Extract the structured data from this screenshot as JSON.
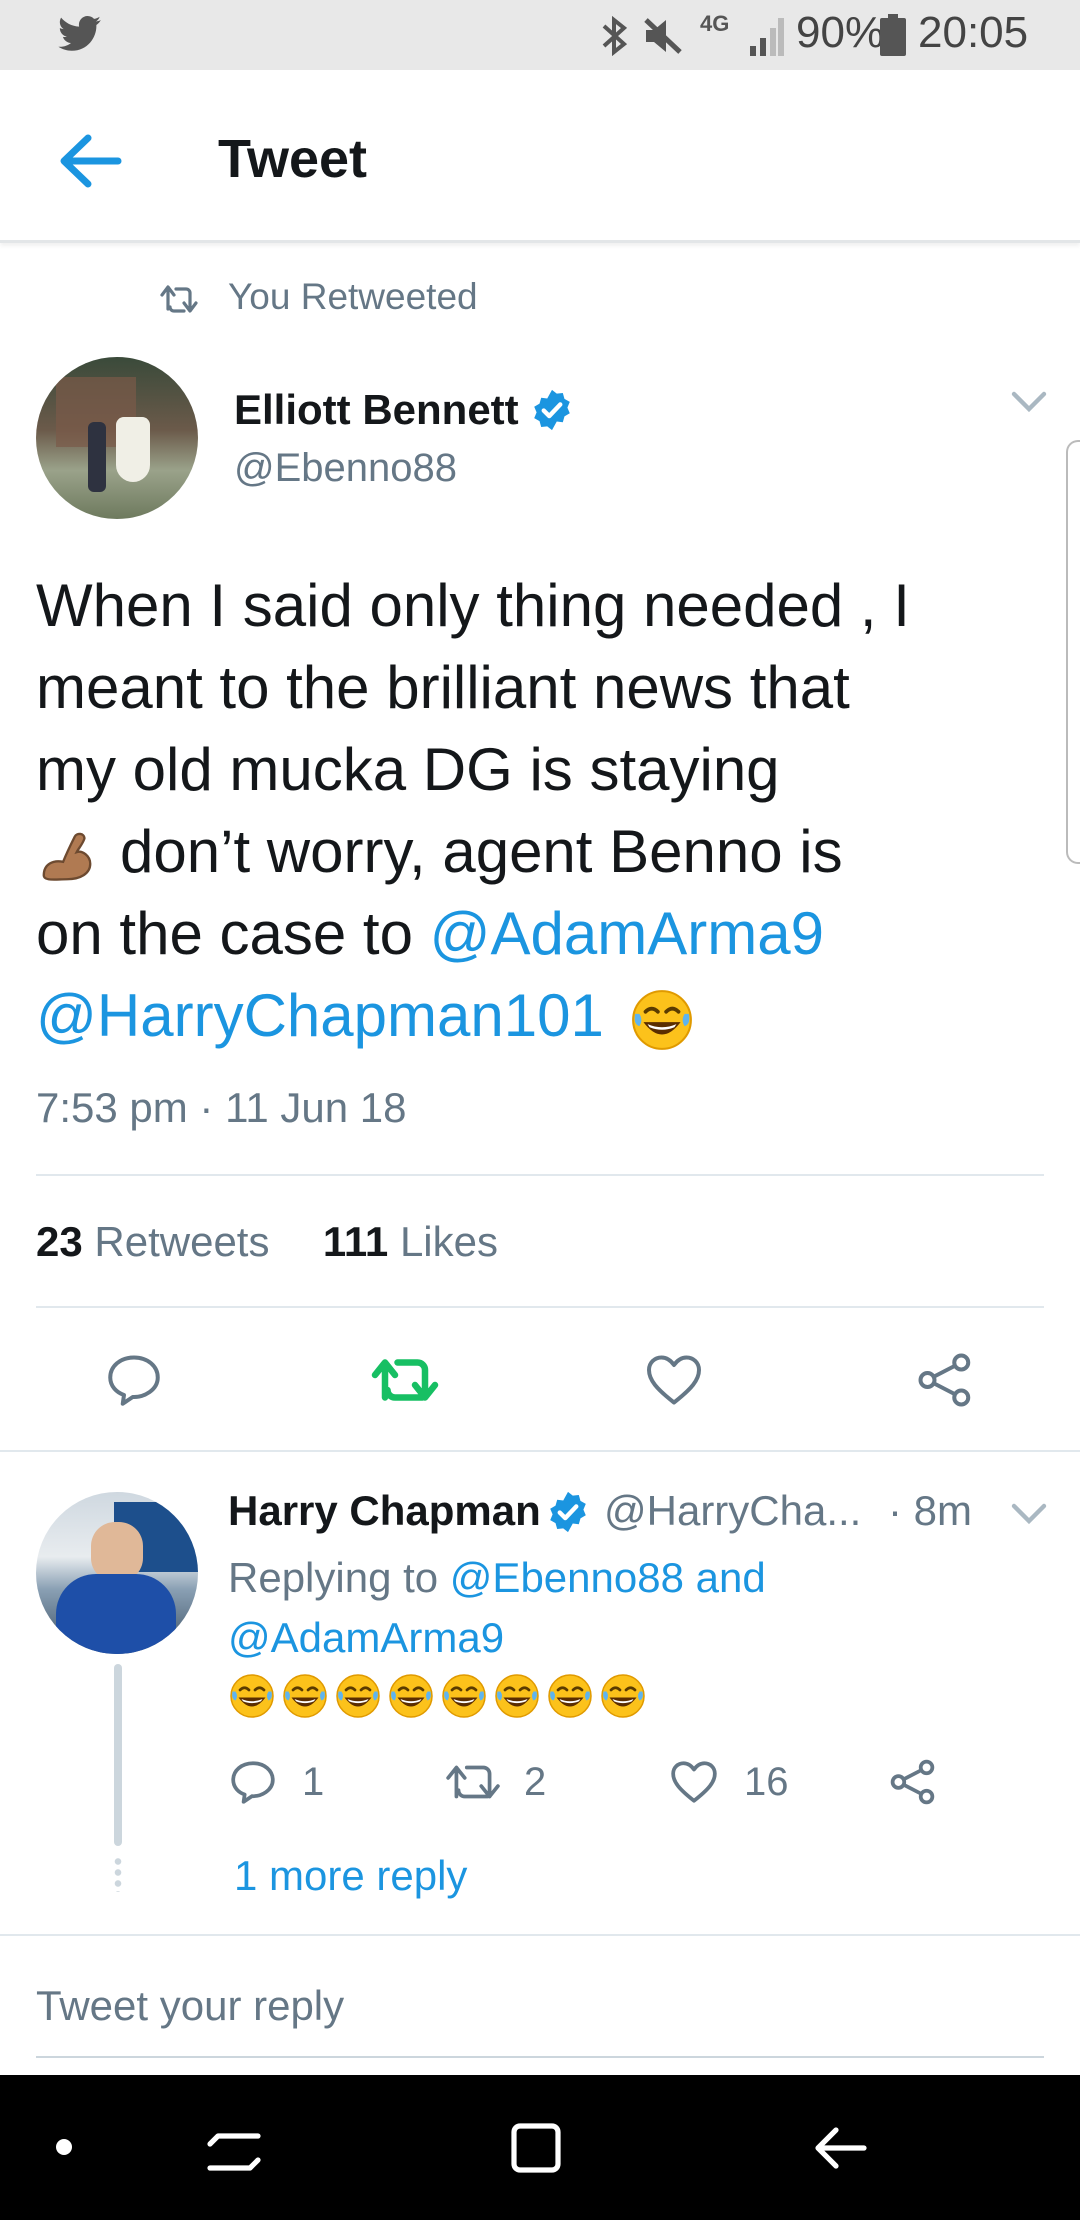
{
  "status_bar": {
    "battery": "90%",
    "time": "20:05",
    "network": "4G"
  },
  "header": {
    "title": "Tweet"
  },
  "retweet_notice": "You Retweeted",
  "tweet": {
    "author_name": "Elliott Bennett",
    "author_handle": "@Ebenno88",
    "text_line1": "When I said only thing needed , I",
    "text_line2": "meant to the brilliant news that",
    "text_line3": "my old mucka DG is staying",
    "text_line4": "don’t worry, agent Benno is",
    "text_line5_prefix": "on the case to ",
    "mention_1": "@AdamArma9",
    "mention_2": "@HarryChapman101",
    "timestamp": "7:53 pm · 11 Jun 18",
    "retweets_count": "23",
    "retweets_label": "Retweets",
    "likes_count": "111",
    "likes_label": "Likes"
  },
  "reply": {
    "author_name": "Harry Chapman",
    "author_handle": "@HarryCha...",
    "time": "· 8m",
    "replying_prefix": "Replying to ",
    "replying_user1": "@Ebenno88",
    "replying_and": " and",
    "replying_user2": "@AdamArma9",
    "reply_count": "1",
    "retweet_count": "2",
    "like_count": "16",
    "more_replies": "1 more reply"
  },
  "composer": {
    "placeholder": "Tweet your reply"
  },
  "colors": {
    "accent": "#1b95e0",
    "retweet_active": "#17bf63",
    "text": "#14171a",
    "secondary": "#657786"
  }
}
